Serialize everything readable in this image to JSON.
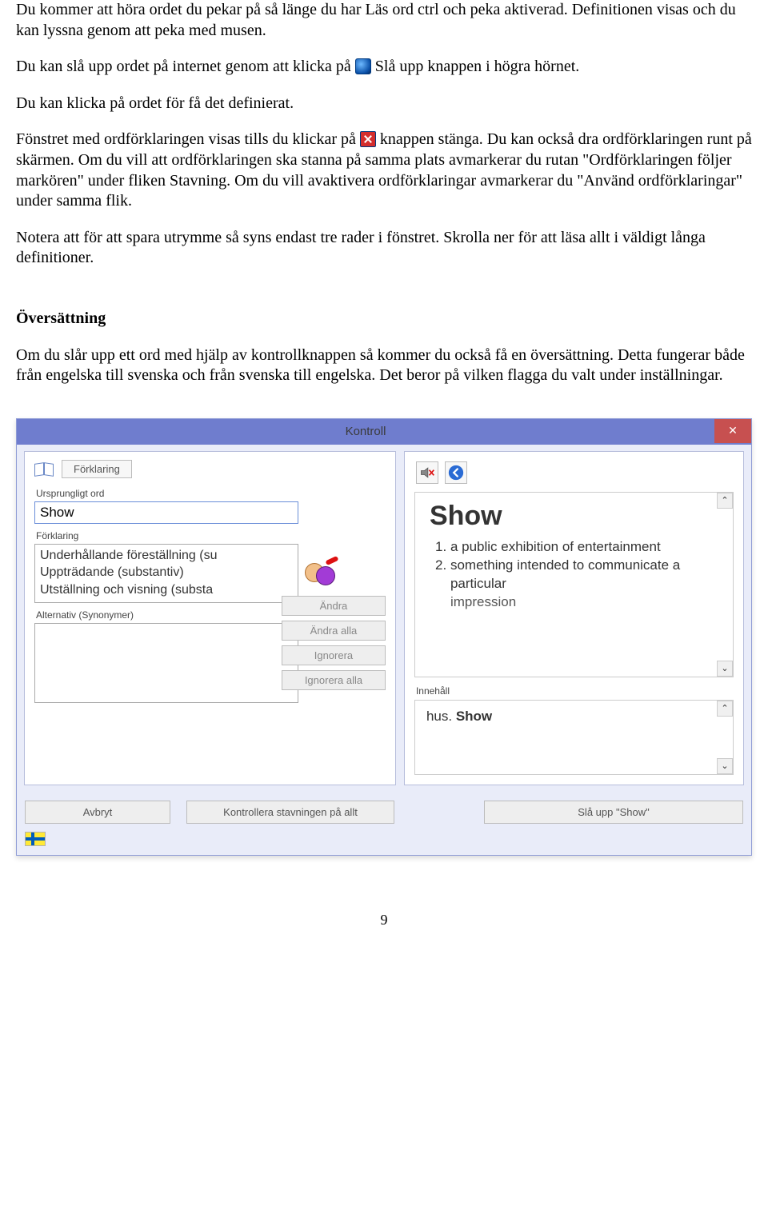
{
  "doc": {
    "p1": "Du kommer att höra ordet du pekar på så länge du har Läs ord ctrl och peka aktiverad. Definitionen visas och du kan lyssna genom att peka med musen.",
    "p2a": "Du kan slå upp ordet på internet genom att klicka på ",
    "p2b": "Slå upp knappen i högra hörnet.",
    "p3": "Du kan klicka på ordet för få det definierat.",
    "p4a": "Fönstret med ordförklaringen visas tills du klickar på ",
    "p4b": "knappen stänga. Du kan också dra ordförklaringen runt på skärmen. Om du vill att ordförklaringen ska stanna på samma plats avmarkerar du rutan \"Ordförklaringen följer markören\" under fliken Stavning. Om du vill avaktivera ordförklaringar avmarkerar du \"Använd ordförklaringar\" under samma flik.",
    "p5": "Notera att för att spara utrymme så syns endast tre rader i fönstret. Skrolla ner för att läsa allt i väldigt långa definitioner.",
    "h1": "Översättning",
    "p6": "Om du slår upp ett ord med hjälp av kontrollknappen så kommer du också få en översättning. Detta fungerar både från engelska till svenska och från svenska till engelska. Det beror på vilken flagga du valt under inställningar.",
    "page_num": "9"
  },
  "app": {
    "title": "Kontroll",
    "left": {
      "tab": "Förklaring",
      "orig_label": "Ursprungligt ord",
      "orig_value": "Show",
      "forkl_label": "Förklaring",
      "forkl_value": "Underhållande föreställning (su\nUppträdande (substantiv)\nUtställning och visning (substa",
      "alt_label": "Alternativ (Synonymer)"
    },
    "buttons": {
      "andra": "Ändra",
      "andra_alla": "Ändra alla",
      "ignorera": "Ignorera",
      "ignorera_alla": "Ignorera alla"
    },
    "right": {
      "heading": "Show",
      "def1": "a public exhibition of entertainment",
      "def2": "something intended to communicate a particular",
      "def2_cut": "imprеssion",
      "innehall_label": "Innehåll",
      "innehall_pre": "hus. ",
      "innehall_bold": "Show"
    },
    "bottom": {
      "avbryt": "Avbryt",
      "kontrollera": "Kontrollera stavningen på allt",
      "sla_upp": "Slå upp \"Show\""
    }
  }
}
